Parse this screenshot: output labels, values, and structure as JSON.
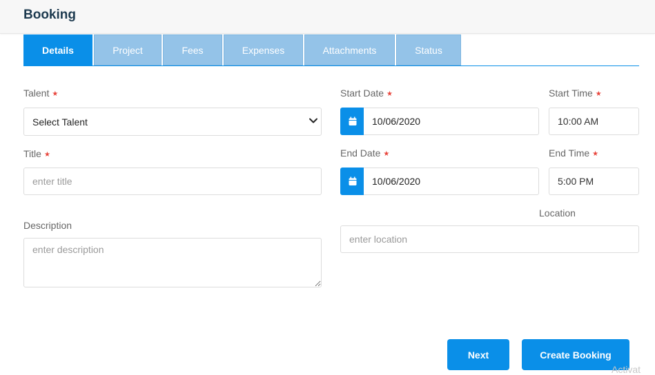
{
  "header": {
    "title": "Booking"
  },
  "tabs": [
    {
      "label": "Details",
      "active": true
    },
    {
      "label": "Project"
    },
    {
      "label": "Fees"
    },
    {
      "label": "Expenses"
    },
    {
      "label": "Attachments"
    },
    {
      "label": "Status"
    }
  ],
  "form": {
    "talent": {
      "label": "Talent",
      "required_mark": "★",
      "selected": "Select Talent"
    },
    "title": {
      "label": "Title",
      "required_mark": "★",
      "placeholder": "enter title"
    },
    "description": {
      "label": "Description",
      "placeholder": "enter description"
    },
    "start_date": {
      "label": "Start Date",
      "required_mark": "★",
      "value": "10/06/2020"
    },
    "start_time": {
      "label": "Start Time",
      "required_mark": "★",
      "value": "10:00 AM"
    },
    "end_date": {
      "label": "End Date",
      "required_mark": "★",
      "value": "10/06/2020"
    },
    "end_time": {
      "label": "End Time",
      "required_mark": "★",
      "value": "5:00 PM"
    },
    "location": {
      "label": "Location",
      "placeholder": "enter location"
    }
  },
  "buttons": {
    "next": "Next",
    "create": "Create Booking"
  },
  "watermark": "Activat",
  "colors": {
    "accent": "#0a8fe8",
    "tab_inactive": "#94c3e8",
    "required": "#e8453c"
  },
  "icons": {
    "date": "calendar-icon",
    "select": "chevron-down-icon"
  }
}
